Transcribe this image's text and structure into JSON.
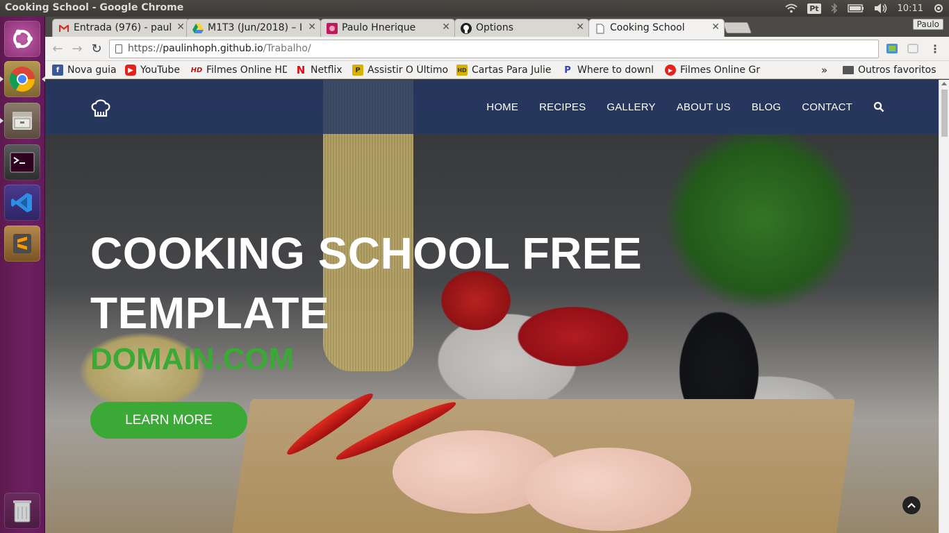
{
  "window": {
    "title": "Cooking School - Google Chrome"
  },
  "tray": {
    "keyboard": "Pt",
    "clock": "10:11"
  },
  "tabs": [
    {
      "label": "Entrada (976) - paul",
      "icon": "gmail-icon"
    },
    {
      "label": "M1T3 (Jun/2018) – I",
      "icon": "google-drive-icon"
    },
    {
      "label": "Paulo Hnerique",
      "icon": "site-icon"
    },
    {
      "label": "Options",
      "icon": "github-icon"
    },
    {
      "label": "Cooking School",
      "icon": "page-icon"
    }
  ],
  "profile": "Paulo",
  "address": {
    "scheme": "https://",
    "host": "paulinhoph.github.io",
    "path": "/Trabalho/"
  },
  "bookmarks": [
    {
      "label": "Nova guia",
      "icon": "facebook-icon",
      "color": "#3b5998"
    },
    {
      "label": "YouTube",
      "icon": "youtube-icon",
      "color": "#e62117"
    },
    {
      "label": "Filmes Online HD",
      "icon": "hd-icon",
      "color": "#c0161a"
    },
    {
      "label": "Netflix",
      "icon": "netflix-icon",
      "color": "#e50914"
    },
    {
      "label": "Assistir O Último",
      "icon": "p-icon",
      "color": "#d8b100"
    },
    {
      "label": "Cartas Para Julie",
      "icon": "hd-icon",
      "color": "#d8b100"
    },
    {
      "label": "Where to downl",
      "icon": "p-icon",
      "color": "#3344bb"
    },
    {
      "label": "Filmes Online Gr",
      "icon": "play-icon",
      "color": "#e62117"
    }
  ],
  "bookmarks_more": "»",
  "other_bookmarks": "Outros favoritos",
  "site": {
    "nav": [
      "HOME",
      "RECIPES",
      "GALLERY",
      "ABOUT US",
      "BLOG",
      "CONTACT"
    ],
    "hero_line1": "COOKING SCHOOL FREE",
    "hero_line2": "TEMPLATE",
    "domain": "DOMAIN.COM",
    "cta": "LEARN MORE"
  },
  "colors": {
    "accent": "#3aa935",
    "header": "#233764",
    "launcher": "#6d2060"
  }
}
